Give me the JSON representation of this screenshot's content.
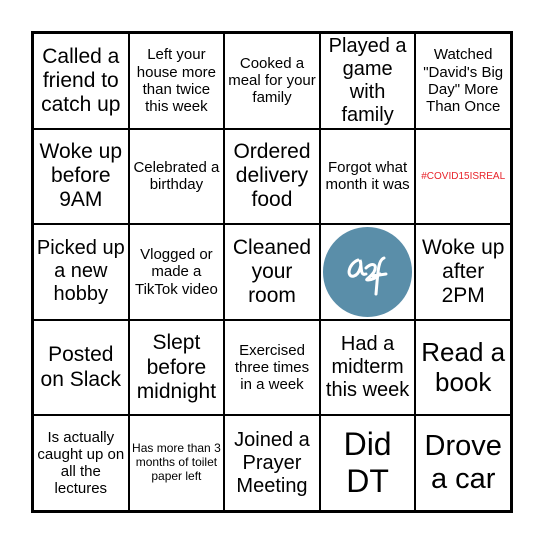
{
  "card": {
    "cells": [
      "Called a friend to catch up",
      "Left your house more than twice this week",
      "Cooked a meal for your family",
      "Played a game with family",
      "Watched \"David's Big Day\" More Than Once",
      "Woke up before 9AM",
      "Celebrated a birthday",
      "Ordered delivery food",
      "Forgot what month it was",
      "#COVID15ISREAL",
      "Picked up a new hobby",
      "Vlogged or made a TikTok video",
      "Cleaned your room",
      "",
      "Woke up after 2PM",
      "Posted on Slack",
      "Slept before midnight",
      "Exercised three times in a week",
      "Had a midterm this week",
      "Read a book",
      "Is actually caught up on all the lectures",
      "Has more than 3 months of toilet paper left",
      "Joined a Prayer Meeting",
      "Did DT",
      "Drove a car"
    ],
    "free_space": {
      "logo_text": "a2f",
      "icon": "logo-circle",
      "color": "#5a8ea9"
    },
    "colors": {
      "highlight_text": "#e8232a",
      "border": "#000000"
    }
  }
}
